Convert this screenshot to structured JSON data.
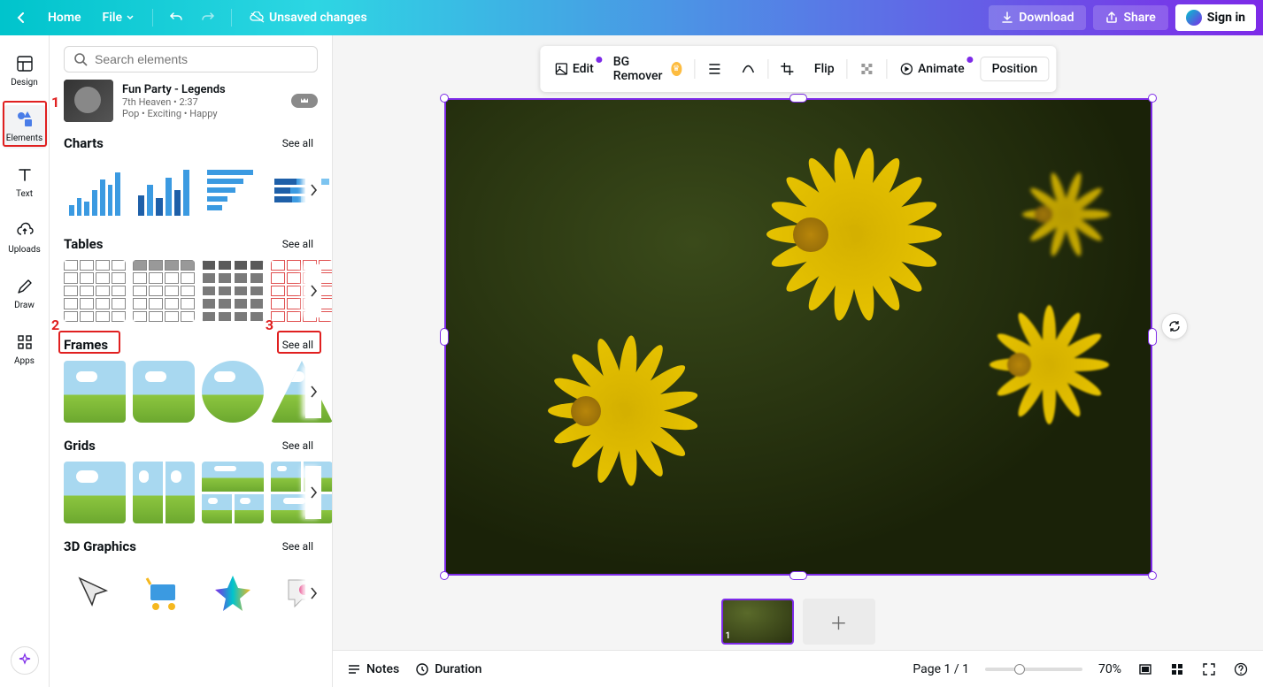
{
  "topbar": {
    "home": "Home",
    "file": "File",
    "status": "Unsaved changes",
    "download": "Download",
    "share": "Share",
    "signin": "Sign in"
  },
  "sidebar": {
    "items": [
      {
        "label": "Design"
      },
      {
        "label": "Elements"
      },
      {
        "label": "Text"
      },
      {
        "label": "Uploads"
      },
      {
        "label": "Draw"
      },
      {
        "label": "Apps"
      }
    ]
  },
  "search": {
    "placeholder": "Search elements"
  },
  "audio": {
    "title": "Fun Party - Legends",
    "artist_duration": "7th Heaven • 2:37",
    "tags": "Pop • Exciting • Happy"
  },
  "sections": {
    "charts": {
      "title": "Charts",
      "see_all": "See all"
    },
    "tables": {
      "title": "Tables",
      "see_all": "See all"
    },
    "frames": {
      "title": "Frames",
      "see_all": "See all"
    },
    "grids": {
      "title": "Grids",
      "see_all": "See all"
    },
    "graphics3d": {
      "title": "3D Graphics",
      "see_all": "See all"
    }
  },
  "toolbar": {
    "edit": "Edit",
    "bg_remover": "BG Remover",
    "flip": "Flip",
    "animate": "Animate",
    "position": "Position"
  },
  "pages": {
    "page_num": "1"
  },
  "bottom": {
    "notes": "Notes",
    "duration": "Duration",
    "page_indicator": "Page 1 / 1",
    "zoom": "70%"
  },
  "annotations": {
    "a1": "1",
    "a2": "2",
    "a3": "3"
  }
}
